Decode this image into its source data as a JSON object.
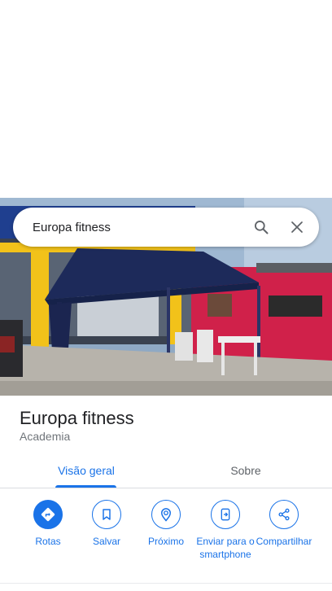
{
  "search": {
    "query": "Europa fitness"
  },
  "place": {
    "name": "Europa fitness",
    "category": "Academia"
  },
  "tabs": [
    {
      "label": "Visão geral",
      "active": true
    },
    {
      "label": "Sobre",
      "active": false
    }
  ],
  "actions": [
    {
      "label": "Rotas",
      "icon": "directions-icon"
    },
    {
      "label": "Salvar",
      "icon": "bookmark-icon"
    },
    {
      "label": "Próximo",
      "icon": "nearby-icon"
    },
    {
      "label": "Enviar para o smartphone",
      "icon": "send-to-phone-icon"
    },
    {
      "label": "Compartilhar",
      "icon": "share-icon"
    }
  ],
  "colors": {
    "accent": "#1a73e8",
    "text": "#202124",
    "secondary": "#70757a"
  }
}
